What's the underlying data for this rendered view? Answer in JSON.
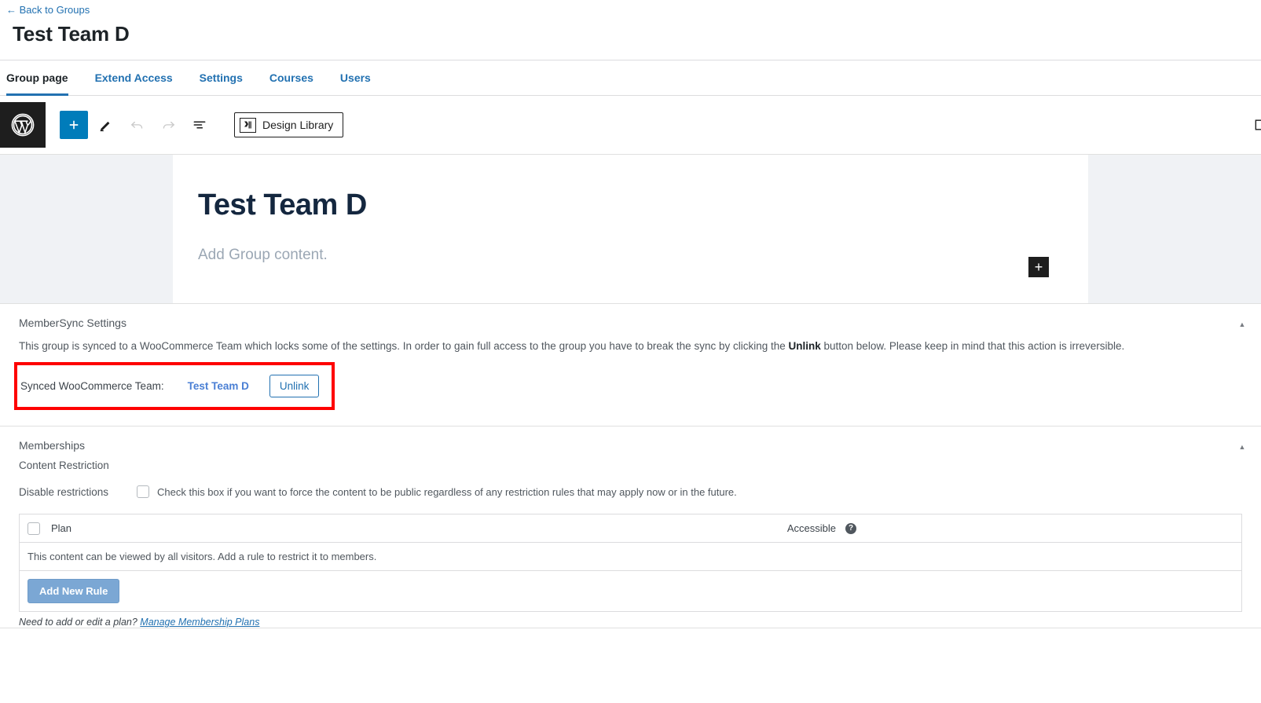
{
  "header": {
    "back_link": "← Back to Groups",
    "title": "Test Team D"
  },
  "tabs": [
    {
      "label": "Group page",
      "active": true
    },
    {
      "label": "Extend Access",
      "active": false
    },
    {
      "label": "Settings",
      "active": false
    },
    {
      "label": "Courses",
      "active": false
    },
    {
      "label": "Users",
      "active": false
    }
  ],
  "editor_toolbar": {
    "wp_logo_icon": "wordpress-logo-icon",
    "add_block_icon": "plus-icon",
    "add_block_glyph": "+",
    "edit_tool_icon": "pencil-icon",
    "undo_icon": "undo-arrow-icon",
    "redo_icon": "redo-arrow-icon",
    "list_view_icon": "list-view-icon",
    "design_library_label": "Design Library",
    "design_library_icon": "design-library-icon"
  },
  "canvas": {
    "title": "Test Team D",
    "placeholder": "Add Group content.",
    "inserter_glyph": "+"
  },
  "membersync": {
    "panel_title": "MemberSync Settings",
    "description_part1": "This group is synced to a WooCommerce Team which locks some of the settings. In order to gain full access to the group you have to break the sync by clicking the ",
    "description_bold": "Unlink",
    "description_part2": " button below. Please keep in mind that this action is irreversible.",
    "sync_label": "Synced WooCommerce Team:",
    "team_link": "Test Team D",
    "unlink_label": "Unlink",
    "collapse_glyph": "▲"
  },
  "memberships": {
    "panel_title": "Memberships",
    "section_title": "Content Restriction",
    "disable_label": "Disable restrictions",
    "disable_desc": "Check this box if you want to force the content to be public regardless of any restriction rules that may apply now or in the future.",
    "collapse_glyph": "▲",
    "table": {
      "col_plan": "Plan",
      "col_accessible": "Accessible",
      "help_glyph": "?",
      "empty_message": "This content can be viewed by all visitors. Add a rule to restrict it to members.",
      "add_rule_label": "Add New Rule"
    },
    "note_text": "Need to add or edit a plan? ",
    "note_link": "Manage Membership Plans"
  },
  "colors": {
    "accent_blue": "#2271b1",
    "annotation_red": "#fe0000",
    "button_blue": "#007cba",
    "canvas_navy": "#14273f"
  }
}
